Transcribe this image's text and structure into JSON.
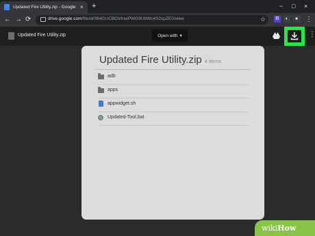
{
  "browser": {
    "tab_title": "Updated Fire Utility.zip - Google",
    "tab_close": "×",
    "new_tab": "+",
    "window_controls": [
      "−",
      "□",
      "×"
    ],
    "nav": {
      "back": "←",
      "forward": "→",
      "reload": "⟳"
    },
    "url_domain": "drive.google.com",
    "url_path": "/file/d/0B4GUCBOVtnwPWG9UbWc4S2xpZE0/view",
    "star": "☆",
    "extensions": [
      {
        "label": "B",
        "color": "#5a3fd0"
      },
      {
        "label": "◐",
        "color": "#3c4043"
      },
      {
        "label": "●",
        "color": "#3c4043"
      }
    ],
    "menu": "⋮"
  },
  "viewer": {
    "file_name": "Updated Fire Utility.zip",
    "open_with_label": "Open with",
    "open_with_caret": "▾",
    "download_icon": "download-icon",
    "download_button_highlight": "#22e84a",
    "more": "⋮"
  },
  "archive": {
    "title": "Updated Fire Utility.zip",
    "item_count": "4 items",
    "items": [
      {
        "name": "adb",
        "icon": "folder-icon"
      },
      {
        "name": "apps",
        "icon": "folder-icon"
      },
      {
        "name": "appwidget.sh",
        "icon": "script-file-icon"
      },
      {
        "name": "Updated-Tool.bat",
        "icon": "bat-file-icon"
      }
    ]
  },
  "watermark": {
    "prefix": "wiki",
    "suffix": "How"
  }
}
